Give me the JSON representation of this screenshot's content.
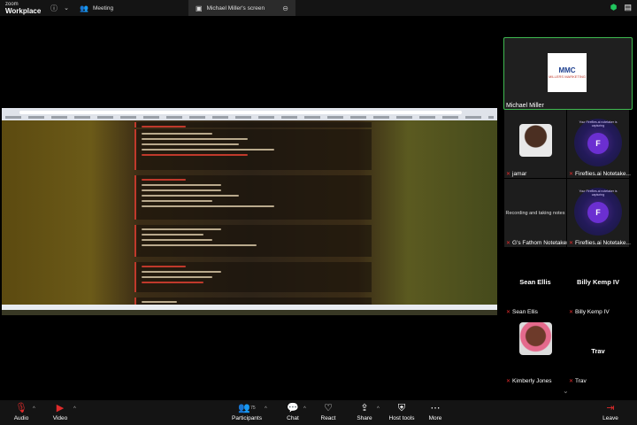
{
  "topbar": {
    "brand_small": "zoom",
    "brand_large": "Workplace",
    "info_icon": "info-icon",
    "chevron": "chevron-down-icon",
    "tabs": [
      {
        "label": "Meeting",
        "icon": "people-icon"
      },
      {
        "label": "Michael Miller's screen",
        "icon": "screen-share-icon"
      }
    ],
    "security_icon": "shield-icon",
    "notes_icon": "notes-icon"
  },
  "participants": [
    {
      "name": "Michael Miller",
      "type": "logo",
      "logo_text": "MMC",
      "logo_sub": "MILLERS MARKETING"
    },
    {
      "name": "jamar",
      "type": "photo"
    },
    {
      "name": "Fireflies.ai Notetake...",
      "type": "fireflies",
      "banner": "Your Fireflies.ai notetaker is capturing"
    },
    {
      "name": "G's Fathom Notetaker",
      "type": "fathom",
      "status": "Recording and taking notes"
    },
    {
      "name": "Fireflies.ai Notetake...",
      "type": "fireflies",
      "banner": "Your Fireflies.ai notetaker is capturing"
    },
    {
      "name": "Sean Ellis",
      "type": "name-only"
    },
    {
      "name": "Billy Kemp IV",
      "type": "name-only"
    },
    {
      "name": "Kimberly Jones",
      "type": "photo"
    },
    {
      "name": "Trav",
      "type": "name-only"
    }
  ],
  "toolbar": {
    "audio": "Audio",
    "video": "Video",
    "participants": "Participants",
    "participant_count": "75",
    "chat": "Chat",
    "react": "React",
    "share": "Share",
    "host_tools": "Host tools",
    "more": "More",
    "leave": "Leave"
  },
  "colors": {
    "accent_green": "#3fb950",
    "mute_red": "#e02b2b",
    "background": "#000000"
  }
}
